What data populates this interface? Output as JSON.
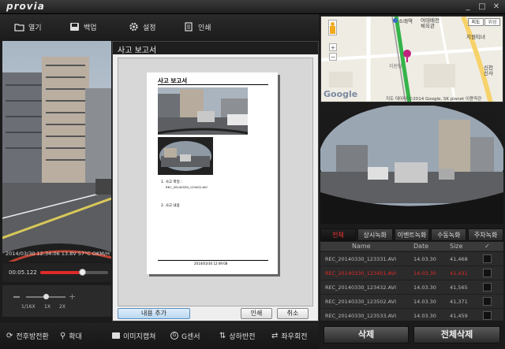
{
  "app": {
    "logo": "provia",
    "min": "_",
    "max": "□",
    "close": "✕"
  },
  "toolbar": {
    "open": "열기",
    "backup": "백업",
    "settings": "설정",
    "print": "인쇄"
  },
  "player": {
    "timestamp": "2014/03/30 12:34:06 13.8V 57°C OKM/H",
    "time": "00:05.122",
    "progress": 0.62,
    "zoom_labels": [
      "1/16X",
      "1X",
      "2X"
    ],
    "zoom_level": 0.5
  },
  "report": {
    "window_title": "사고 보고서",
    "doc_title": "사고 보고서",
    "item1": "1. 사고 파일 :",
    "item1_value": "REC_20140330_123401.AVI",
    "item2": "2. 사고 내용",
    "footer": "2014/03/30 12:49:08",
    "add_content": "내용 추가",
    "print": "인쇄",
    "cancel": "취소"
  },
  "map": {
    "labels": {
      "station": "소래역",
      "gym": "여태배전\n체육관",
      "district": "지원티녀",
      "sinchon": "신천\n신사",
      "jawon": "지원팀"
    },
    "map_btn": "지도",
    "satellite": "위성",
    "google": "Google",
    "copyright": "지도 데이터 ©2014 Google, SK planet 이용약관"
  },
  "tabs": [
    "전체",
    "상시녹화",
    "이벤트녹화",
    "수동녹화",
    "주차녹화"
  ],
  "list": {
    "headers": {
      "name": "Name",
      "date": "Date",
      "size": "Size",
      "check": "✓"
    },
    "rows": [
      {
        "name": "REC_20140330_123331.AVI",
        "date": "14.03.30",
        "size": "41,468",
        "active": false
      },
      {
        "name": "REC_20140330_123401.AVI",
        "date": "14.03.30",
        "size": "41,431",
        "active": true
      },
      {
        "name": "REC_20140330_123432.AVI",
        "date": "14.03.30",
        "size": "41,565",
        "active": false
      },
      {
        "name": "REC_20140330_123502.AVI",
        "date": "14.03.30",
        "size": "41,371",
        "active": false
      },
      {
        "name": "REC_20140330_123533.AVI",
        "date": "14.03.30",
        "size": "41,459",
        "active": false
      }
    ]
  },
  "actions": {
    "delete": "삭제",
    "delete_all": "전체삭제"
  },
  "bottombar": {
    "front_rear": "전후방전환",
    "zoom": "확대",
    "capture": "이미지캡쳐",
    "gsensor": "G센서",
    "flip_v": "상하반전",
    "flip_h": "좌우회전"
  },
  "colors": {
    "accent": "#e02a2a",
    "map_route": "#35b34a"
  }
}
